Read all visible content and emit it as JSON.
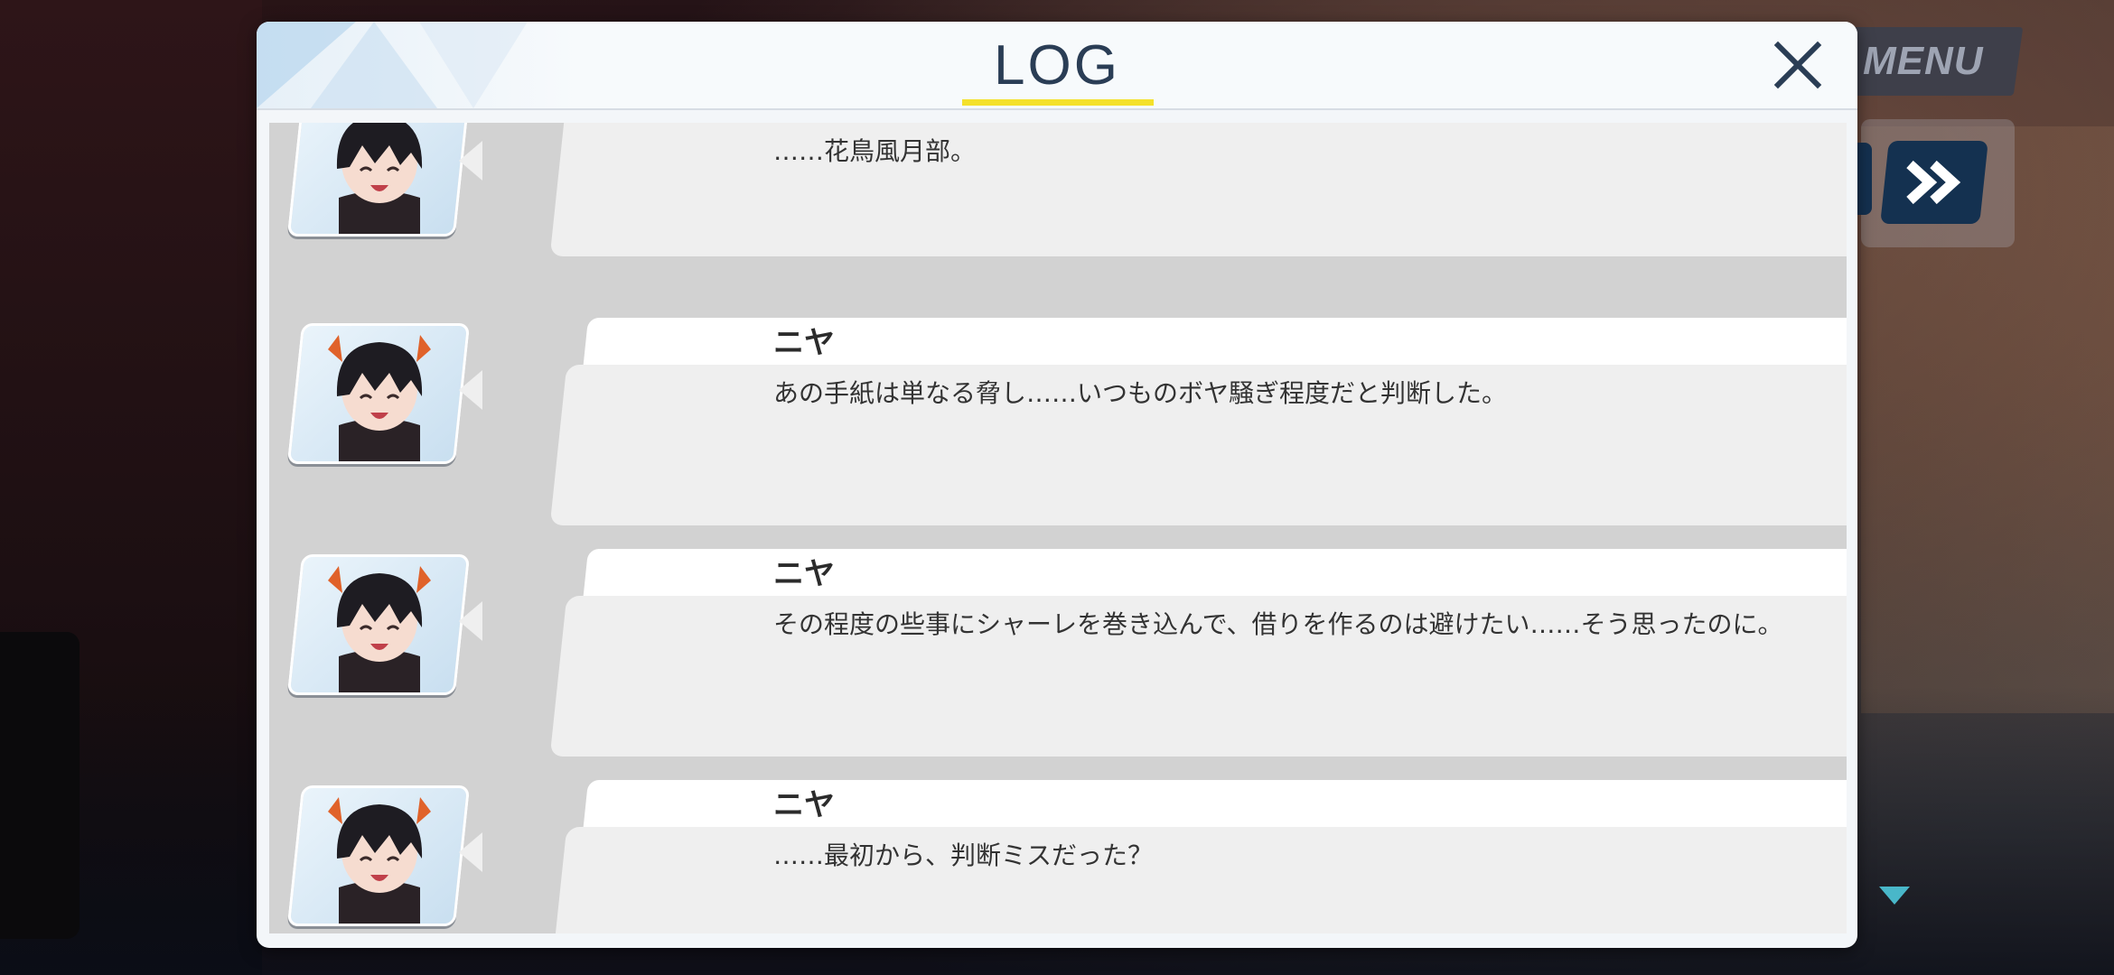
{
  "hud": {
    "menu_label": "MENU"
  },
  "log_window": {
    "title": "LOG",
    "accent_color": "#f4e12b",
    "close_icon": "close-icon",
    "entries": [
      {
        "speaker": "",
        "text": "……花鳥風月部。"
      },
      {
        "speaker": "ニヤ",
        "text": "あの手紙は単なる脅し……いつものボヤ騒ぎ程度だと判断した。"
      },
      {
        "speaker": "ニヤ",
        "text": "その程度の些事にシャーレを巻き込んで、借りを作るのは避けたい……そう思ったのに。"
      },
      {
        "speaker": "ニヤ",
        "text": "……最初から、判断ミスだった？"
      }
    ]
  }
}
